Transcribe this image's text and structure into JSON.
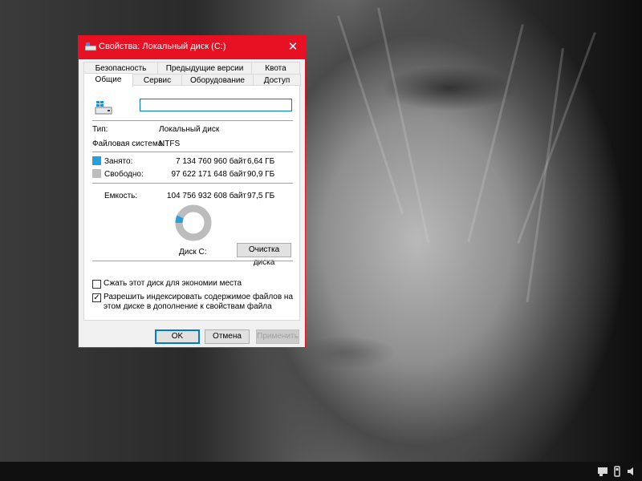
{
  "window": {
    "title": "Свойства: Локальный диск (C:)",
    "close_symbol": "✕"
  },
  "tabs": {
    "row_top": [
      "Безопасность",
      "Предыдущие версии",
      "Квота"
    ],
    "row_bottom": [
      "Общие",
      "Сервис",
      "Оборудование",
      "Доступ"
    ],
    "active": "Общие"
  },
  "general": {
    "drive_name_value": "",
    "type_label": "Тип:",
    "type_value": "Локальный диск",
    "fs_label": "Файловая система:",
    "fs_value": "NTFS",
    "used_label": "Занято:",
    "used_bytes": "7 134 760 960 байт",
    "used_size": "6,64 ГБ",
    "free_label": "Свободно:",
    "free_bytes": "97 622 171 648 байт",
    "free_size": "90,9 ГБ",
    "capacity_label": "Емкость:",
    "capacity_bytes": "104 756 932 608 байт",
    "capacity_size": "97,5 ГБ",
    "disk_label": "Диск C:",
    "cleanup_button": "Очистка диска",
    "used_fraction": 0.068,
    "used_color": "#26a0da",
    "free_color": "#bcbcbc"
  },
  "options": {
    "compress_label": "Сжать этот диск для экономии места",
    "compress_checked": false,
    "index_label": "Разрешить индексировать содержимое файлов на этом диске в дополнение к свойствам файла",
    "index_checked": true
  },
  "buttons": {
    "ok": "OK",
    "cancel": "Отмена",
    "apply": "Применить"
  },
  "taskbar": {
    "icons": [
      "action-center-icon",
      "usb-drive-icon",
      "volume-icon"
    ]
  },
  "colors": {
    "title_bar": "#e81123",
    "accent": "#0078d7"
  }
}
